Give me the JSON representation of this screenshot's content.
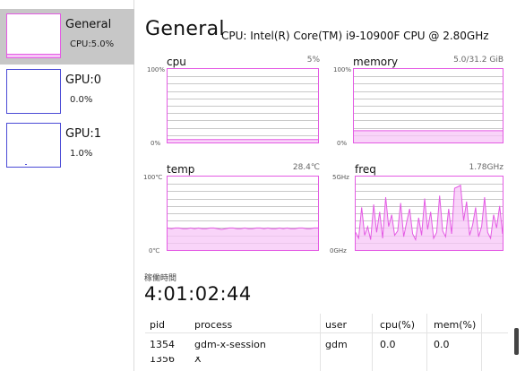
{
  "colors": {
    "accent": "#e45be4",
    "fill": "#f7c6f7",
    "grid": "#c8c8c8",
    "blue_border": "#4b4bd6",
    "selected_bg": "#c7c7c7"
  },
  "sidebar": {
    "items": [
      {
        "name": "General",
        "value": "CPU:5.0%"
      },
      {
        "name": "GPU:0",
        "value": "0.0%"
      },
      {
        "name": "GPU:1",
        "value": "1.0%"
      }
    ]
  },
  "header": {
    "title": "General",
    "cpu_name": "CPU: Intel(R) Core(TM) i9-10900F CPU @ 2.80GHz"
  },
  "panels": {
    "cpu": {
      "name": "cpu",
      "value": "5%",
      "ymax": "100%",
      "ymin": "0%"
    },
    "memory": {
      "name": "memory",
      "value": "5.0/31.2 GiB",
      "ymax": "100%",
      "ymin": "0%"
    },
    "temp": {
      "name": "temp",
      "value": "28.4℃",
      "ymax": "100℃",
      "ymin": "0℃"
    },
    "freq": {
      "name": "freq",
      "value": "1.78GHz",
      "ymax": "5GHz",
      "ymin": "0GHz"
    }
  },
  "uptime": {
    "label": "稼働時間",
    "value": "4:01:02:44"
  },
  "process_table": {
    "headers": [
      "pid",
      "process",
      "user",
      "cpu(%)",
      "mem(%)"
    ],
    "rows": [
      [
        "1354",
        "gdm-x-session",
        "gdm",
        "0.0",
        "0.0"
      ]
    ]
  }
}
